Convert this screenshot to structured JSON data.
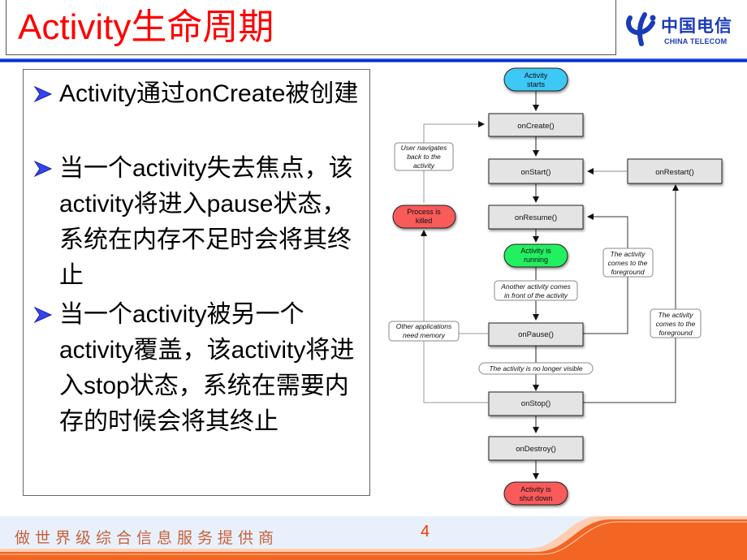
{
  "slide": {
    "title": "Activity生命周期",
    "page_number": "4"
  },
  "logo": {
    "icon": "china-telecom-logo-icon",
    "name_cn": "中国电信",
    "name_en": "CHINA TELECOM"
  },
  "footer": {
    "slogan": "做世界级综合信息服务提供商"
  },
  "bullets": [
    {
      "icon": "arrow-bullet-icon",
      "text": "Activity通过onCreate被创建"
    },
    {
      "icon": "arrow-bullet-icon",
      "text": "当一个activity失去焦点，该activity将进入pause状态，系统在内存不足时会将其终止"
    },
    {
      "icon": "arrow-bullet-icon",
      "text": "当一个activity被另一个activity覆盖，该activity将进入stop状态，系统在需要内存的时候会将其终止"
    }
  ],
  "colors": {
    "title": "#ff0000",
    "start_node": "#3ec8f5",
    "running_node": "#22f060",
    "terminal_node": "#f95a5a",
    "method_box": "#e4e4e4",
    "footer_orange": "#f26522",
    "header_rule": "#0030e0"
  },
  "diagram": {
    "nodes": {
      "start": "Activity starts",
      "onCreate": "onCreate()",
      "onStart": "onStart()",
      "onRestart": "onRestart()",
      "onResume": "onResume()",
      "running": "Activity is running",
      "onPause": "onPause()",
      "onStop": "onStop()",
      "onDestroy": "onDestroy()",
      "shutdown": "Activity is shut down",
      "killed": "Process is killed"
    },
    "labels": {
      "user_navigates": [
        "User navigates",
        "back to the",
        "activity"
      ],
      "another_activity": [
        "Another activity comes",
        "in front of the activity"
      ],
      "other_apps": [
        "Other applications",
        "need memory"
      ],
      "no_longer_visible": "The activity is no longer visible",
      "foreground_1": [
        "The activity",
        "comes to the",
        "foreground"
      ],
      "foreground_2": [
        "The activity",
        "comes to the",
        "foreground"
      ]
    }
  }
}
